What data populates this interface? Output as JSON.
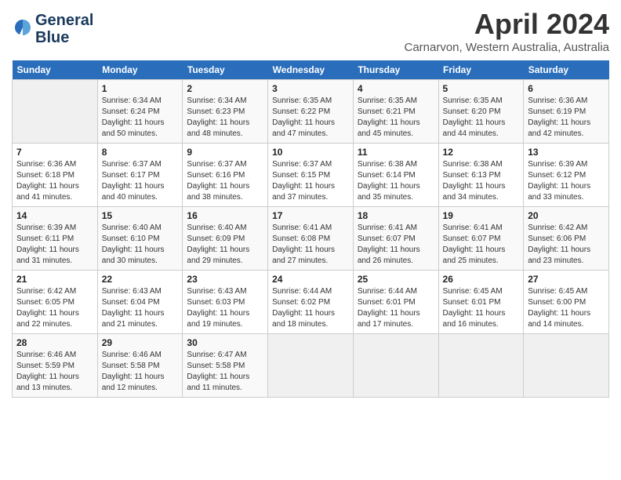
{
  "header": {
    "logo_line1": "General",
    "logo_line2": "Blue",
    "month_year": "April 2024",
    "location": "Carnarvon, Western Australia, Australia"
  },
  "days_of_week": [
    "Sunday",
    "Monday",
    "Tuesday",
    "Wednesday",
    "Thursday",
    "Friday",
    "Saturday"
  ],
  "weeks": [
    [
      {
        "day": "",
        "info": ""
      },
      {
        "day": "1",
        "info": "Sunrise: 6:34 AM\nSunset: 6:24 PM\nDaylight: 11 hours\nand 50 minutes."
      },
      {
        "day": "2",
        "info": "Sunrise: 6:34 AM\nSunset: 6:23 PM\nDaylight: 11 hours\nand 48 minutes."
      },
      {
        "day": "3",
        "info": "Sunrise: 6:35 AM\nSunset: 6:22 PM\nDaylight: 11 hours\nand 47 minutes."
      },
      {
        "day": "4",
        "info": "Sunrise: 6:35 AM\nSunset: 6:21 PM\nDaylight: 11 hours\nand 45 minutes."
      },
      {
        "day": "5",
        "info": "Sunrise: 6:35 AM\nSunset: 6:20 PM\nDaylight: 11 hours\nand 44 minutes."
      },
      {
        "day": "6",
        "info": "Sunrise: 6:36 AM\nSunset: 6:19 PM\nDaylight: 11 hours\nand 42 minutes."
      }
    ],
    [
      {
        "day": "7",
        "info": "Sunrise: 6:36 AM\nSunset: 6:18 PM\nDaylight: 11 hours\nand 41 minutes."
      },
      {
        "day": "8",
        "info": "Sunrise: 6:37 AM\nSunset: 6:17 PM\nDaylight: 11 hours\nand 40 minutes."
      },
      {
        "day": "9",
        "info": "Sunrise: 6:37 AM\nSunset: 6:16 PM\nDaylight: 11 hours\nand 38 minutes."
      },
      {
        "day": "10",
        "info": "Sunrise: 6:37 AM\nSunset: 6:15 PM\nDaylight: 11 hours\nand 37 minutes."
      },
      {
        "day": "11",
        "info": "Sunrise: 6:38 AM\nSunset: 6:14 PM\nDaylight: 11 hours\nand 35 minutes."
      },
      {
        "day": "12",
        "info": "Sunrise: 6:38 AM\nSunset: 6:13 PM\nDaylight: 11 hours\nand 34 minutes."
      },
      {
        "day": "13",
        "info": "Sunrise: 6:39 AM\nSunset: 6:12 PM\nDaylight: 11 hours\nand 33 minutes."
      }
    ],
    [
      {
        "day": "14",
        "info": "Sunrise: 6:39 AM\nSunset: 6:11 PM\nDaylight: 11 hours\nand 31 minutes."
      },
      {
        "day": "15",
        "info": "Sunrise: 6:40 AM\nSunset: 6:10 PM\nDaylight: 11 hours\nand 30 minutes."
      },
      {
        "day": "16",
        "info": "Sunrise: 6:40 AM\nSunset: 6:09 PM\nDaylight: 11 hours\nand 29 minutes."
      },
      {
        "day": "17",
        "info": "Sunrise: 6:41 AM\nSunset: 6:08 PM\nDaylight: 11 hours\nand 27 minutes."
      },
      {
        "day": "18",
        "info": "Sunrise: 6:41 AM\nSunset: 6:07 PM\nDaylight: 11 hours\nand 26 minutes."
      },
      {
        "day": "19",
        "info": "Sunrise: 6:41 AM\nSunset: 6:07 PM\nDaylight: 11 hours\nand 25 minutes."
      },
      {
        "day": "20",
        "info": "Sunrise: 6:42 AM\nSunset: 6:06 PM\nDaylight: 11 hours\nand 23 minutes."
      }
    ],
    [
      {
        "day": "21",
        "info": "Sunrise: 6:42 AM\nSunset: 6:05 PM\nDaylight: 11 hours\nand 22 minutes."
      },
      {
        "day": "22",
        "info": "Sunrise: 6:43 AM\nSunset: 6:04 PM\nDaylight: 11 hours\nand 21 minutes."
      },
      {
        "day": "23",
        "info": "Sunrise: 6:43 AM\nSunset: 6:03 PM\nDaylight: 11 hours\nand 19 minutes."
      },
      {
        "day": "24",
        "info": "Sunrise: 6:44 AM\nSunset: 6:02 PM\nDaylight: 11 hours\nand 18 minutes."
      },
      {
        "day": "25",
        "info": "Sunrise: 6:44 AM\nSunset: 6:01 PM\nDaylight: 11 hours\nand 17 minutes."
      },
      {
        "day": "26",
        "info": "Sunrise: 6:45 AM\nSunset: 6:01 PM\nDaylight: 11 hours\nand 16 minutes."
      },
      {
        "day": "27",
        "info": "Sunrise: 6:45 AM\nSunset: 6:00 PM\nDaylight: 11 hours\nand 14 minutes."
      }
    ],
    [
      {
        "day": "28",
        "info": "Sunrise: 6:46 AM\nSunset: 5:59 PM\nDaylight: 11 hours\nand 13 minutes."
      },
      {
        "day": "29",
        "info": "Sunrise: 6:46 AM\nSunset: 5:58 PM\nDaylight: 11 hours\nand 12 minutes."
      },
      {
        "day": "30",
        "info": "Sunrise: 6:47 AM\nSunset: 5:58 PM\nDaylight: 11 hours\nand 11 minutes."
      },
      {
        "day": "",
        "info": ""
      },
      {
        "day": "",
        "info": ""
      },
      {
        "day": "",
        "info": ""
      },
      {
        "day": "",
        "info": ""
      }
    ]
  ]
}
